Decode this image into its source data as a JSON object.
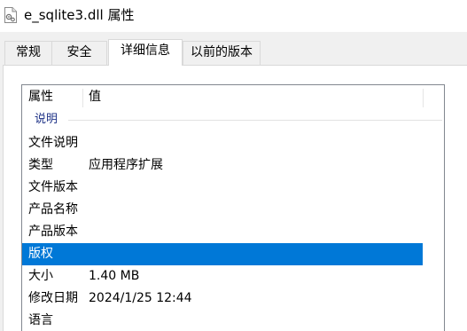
{
  "window": {
    "title": "e_sqlite3.dll 属性",
    "icon": "dll-file-icon"
  },
  "tabs": [
    {
      "label": "常规",
      "active": false
    },
    {
      "label": "安全",
      "active": false
    },
    {
      "label": "详细信息",
      "active": true
    },
    {
      "label": "以前的版本",
      "active": false
    }
  ],
  "details": {
    "columns": {
      "property": "属性",
      "value": "值"
    },
    "group_label": "说明",
    "rows": [
      {
        "property": "文件说明",
        "value": "",
        "selected": false
      },
      {
        "property": "类型",
        "value": "应用程序扩展",
        "selected": false
      },
      {
        "property": "文件版本",
        "value": "",
        "selected": false
      },
      {
        "property": "产品名称",
        "value": "",
        "selected": false
      },
      {
        "property": "产品版本",
        "value": "",
        "selected": false
      },
      {
        "property": "版权",
        "value": "",
        "selected": true
      },
      {
        "property": "大小",
        "value": "1.40 MB",
        "selected": false
      },
      {
        "property": "修改日期",
        "value": "2024/1/25 12:44",
        "selected": false
      },
      {
        "property": "语言",
        "value": "",
        "selected": false
      }
    ]
  },
  "colors": {
    "selection": "#0078d7",
    "group_label": "#1e3287"
  }
}
